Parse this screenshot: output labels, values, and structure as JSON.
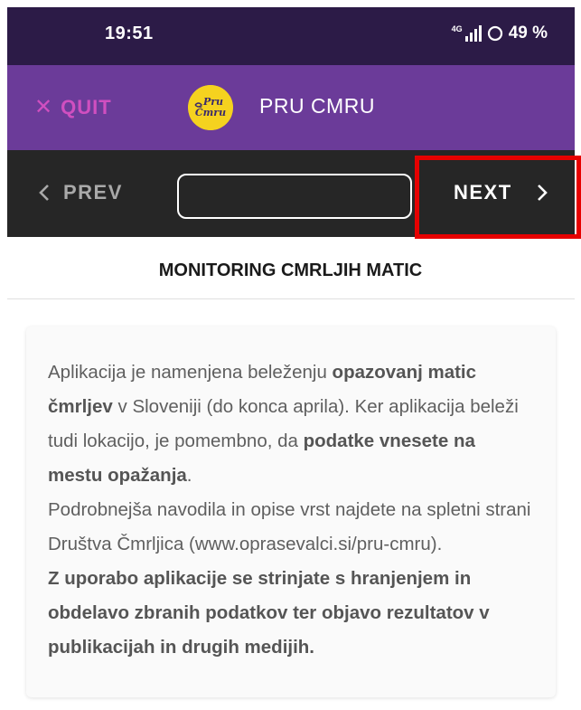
{
  "status_bar": {
    "time": "19:51",
    "network": "4G",
    "battery": "49 %"
  },
  "app_bar": {
    "quit_label": "QUIT",
    "logo_text_top": "Pru",
    "logo_text_bottom": "Čmru",
    "title": "PRU CMRU"
  },
  "nav": {
    "prev_label": "PREV",
    "next_label": "NEXT",
    "page_input_value": ""
  },
  "page": {
    "title": "MONITORING CMRLJIH MATIC"
  },
  "info": {
    "p1_a": "Aplikacija je namenjena beleženju ",
    "p1_b": "opazovanj matic čmrljev",
    "p1_c": " v Sloveniji (do konca aprila). Ker aplikacija beleži tudi lokacijo, je pomembno, da ",
    "p1_d": "podatke vnesete na mestu opažanja",
    "p1_e": ".",
    "p2": "Podrobnejša navodila in opise vrst najdete na spletni strani Društva Čmrljica (www.oprasevalci.si/pru-cmru).",
    "p3": "Z uporabo aplikacije se strinjate s hranjenjem in obdelavo zbranih podatkov ter objavo rezultatov v publikacijah in drugih medijih."
  },
  "colors": {
    "status_bar": "#2c1b47",
    "app_bar": "#6b3b99",
    "nav_bar": "#262626",
    "quit": "#d04fc0",
    "logo": "#f5d21f",
    "highlight": "#e60000"
  }
}
